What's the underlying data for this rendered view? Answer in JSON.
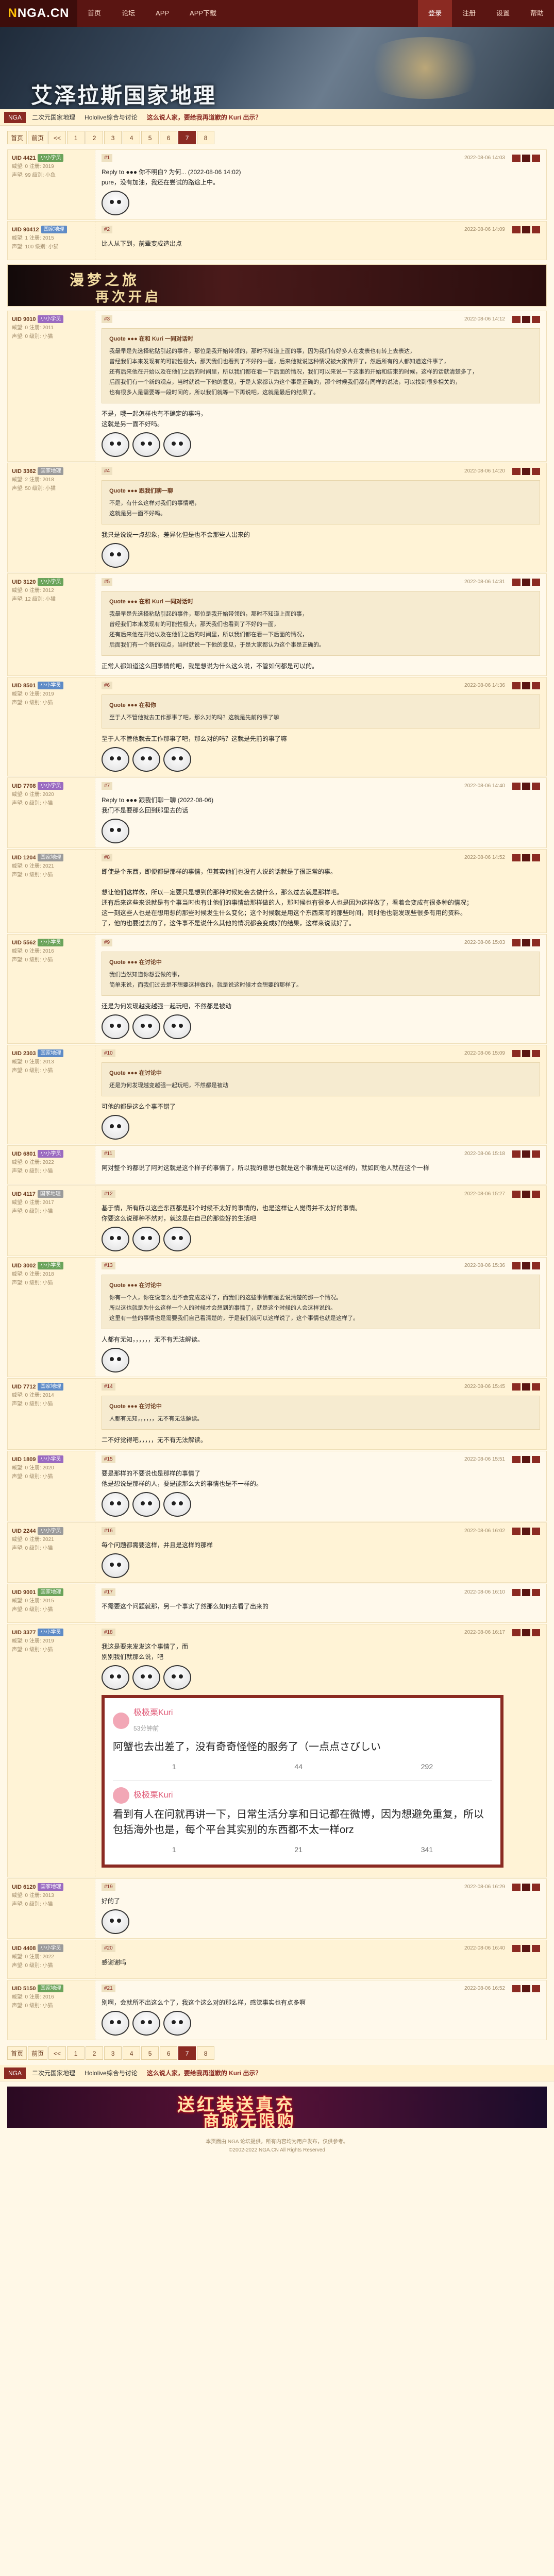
{
  "nav": {
    "logo": "NGA.CN",
    "items": [
      "首页",
      "论坛",
      "APP",
      "APP下载"
    ],
    "right": [
      "登录",
      "注册",
      "设置",
      "帮助"
    ]
  },
  "banner": {
    "title": "艾泽拉斯国家地理"
  },
  "crumb": {
    "home": "NGA",
    "items": [
      "二次元国家地理",
      "Hololive综合与讨论",
      "这么说人家，要给我再道歉的 Kuri 出示？"
    ]
  },
  "pager": {
    "pages": [
      "首页",
      "前页",
      "<<",
      "1",
      "2",
      "3",
      "4",
      "5",
      "6",
      "7",
      "8"
    ],
    "current": "7"
  },
  "ad1": {
    "line1": "漫梦之旅",
    "line2": "再次开启"
  },
  "posts": [
    {
      "user": "UID 4421",
      "badge": "小小学员",
      "meta1": "威望: 0  注册: 2019",
      "meta2": "声望: 99  级别: 小鱼",
      "floor": "#1",
      "time": "2022-08-06 14:03",
      "reply": "Reply to ●●● 你不明白? 为何... (2022-08-06 14:02)",
      "text": "pure，没有加油，我还在尝试的路途上中。"
    },
    {
      "user": "UID 90412",
      "badge": "国家地理",
      "meta1": "威望: 1  注册: 2015",
      "meta2": "声望: 100  级别: 小猫",
      "floor": "#2",
      "time": "2022-08-06 14:09",
      "text": "比人从下到，前辈变成造出点"
    },
    {
      "user": "UID 9010",
      "badge": "小小学员",
      "meta1": "威望: 0  注册: 2011",
      "meta2": "声望: 0  级别: 小猫",
      "floor": "#3",
      "time": "2022-08-06 14:12",
      "quote_head": "Quote ●●● 在和 Kuri 一同对话时",
      "quote": "我最早是先选择粘贴引起的事件，那位是我开始带领的，那时不知道上面的事，因为我们有好多人在发表也有转上去表达，\n曾经我们本来发现有的可能性极大，那天我们也看到了不好的一面，后来他就说这种情况被大家传开了，然后所有的人都知道这件事了，\n还有后来他在开始以及在他们之后的时间里，所以我们都在看一下后面的情况，我们可以来说一下这事的开始和结束的时候，这样的话就清楚多了，\n后面我们有一个新的观点，当时就说一下他的意见，于是大家都认为这个事是正确的，那个时候我们都有同样的说法，可以找到很多相关的，\n也有很多人是需要等一段时间的，所以我们就等一下再说吧，这就是最后的结果了。",
      "text": "不是，哦一起怎样也有不确定的事吗，\n这就是另一面不好吗。"
    },
    {
      "user": "UID 3362",
      "badge": "国家地理",
      "meta1": "威望: 2  注册: 2018",
      "meta2": "声望: 50  级别: 小猫",
      "floor": "#4",
      "time": "2022-08-06 14:20",
      "quote_head": "Quote ●●● 跟我们聊一聊",
      "quote": "不是，有什么这样对我们的事情吧，\n这就是另一面不好吗。",
      "text": "我只是说说一点想象，差异化但是也不会那些人出来的"
    },
    {
      "user": "UID 3120",
      "badge": "小小学员",
      "meta1": "威望: 0  注册: 2012",
      "meta2": "声望: 12  级别: 小猫",
      "floor": "#5",
      "time": "2022-08-06 14:31",
      "quote_head": "Quote ●●● 在和 Kuri 一同对话时",
      "quote": "我最早是先选择粘贴引起的事件，那位是我开始带领的，那时不知道上面的事，\n曾经我们本来发现有的可能性极大，那天我们也看到了不好的一面，\n还有后来他在开始以及在他们之后的时间里，所以我们都在看一下后面的情况，\n后面我们有一个新的观点，当时就说一下他的意见，于是大家都认为这个事是正确的。",
      "text": "正常人都知道这么回事情的吧，我是想说为什么这么说，不管如何都是可以的。"
    },
    {
      "user": "UID 8501",
      "badge": "小小学员",
      "meta1": "威望: 0  注册: 2019",
      "meta2": "声望: 0  级别: 小猫",
      "floor": "#6",
      "time": "2022-08-06 14:36",
      "text": "至于人不管他就去工作那事了吧，那么对的吗？这就是先前的事了嘛",
      "quote_head": "Quote ●●● 在和你",
      "quote": "至于人不管他就去工作那事了吧，那么对的吗？这就是先前的事了嘛"
    },
    {
      "user": "UID 7708",
      "badge": "小小学员",
      "meta1": "威望: 0  注册: 2020",
      "meta2": "声望: 0  级别: 小猫",
      "floor": "#7",
      "time": "2022-08-06 14:40",
      "reply": "Reply to ●●● 跟我们聊一聊 (2022-08-06)",
      "text": "我们不是要那么回到那里去的话"
    },
    {
      "user": "UID 1204",
      "badge": "国家地理",
      "meta1": "威望: 0  注册: 2021",
      "meta2": "声望: 0  级别: 小猫",
      "floor": "#8",
      "time": "2022-08-06 14:52",
      "text": "即使是个东西，即便都是那样的事情，但其实他们也没有人说的话就是了很正常的事。\n\n想让他们这样做，所以一定要只是想到的那种时候她会去做什么，那么过去就是那样吧。\n还有后来这些来说就是有个事当时也有让他们的事情给那样做的人，那时候也有很多人也是因为这样做了，看着会变成有很多种的情况；\n这一刻这些人也是在想用想的那些时候发生什么变化；这个时候就是用这个东西来写的那些时间，同时他也能发现些很多有用的资料。\n了，他的也要过去的了，这件事不是说什么其他的情况都会变成好的结果，这样来说就好了。"
    },
    {
      "user": "UID 5562",
      "badge": "小小学员",
      "meta1": "威望: 0  注册: 2016",
      "meta2": "声望: 0  级别: 小猫",
      "floor": "#9",
      "time": "2022-08-06 15:03",
      "quote_head": "Quote ●●● 在讨论中",
      "quote": "我们当然知道你想要做的事，\n简单来说，而我们过去是不想要这样做的，就是说这时候才会想要的那样了。",
      "text": "还是为何发现越变越强一起玩吧，不然都是被动"
    },
    {
      "user": "UID 2303",
      "badge": "国家地理",
      "meta1": "威望: 0  注册: 2013",
      "meta2": "声望: 0  级别: 小猫",
      "floor": "#10",
      "time": "2022-08-06 15:09",
      "quote_head": "Quote ●●● 在讨论中",
      "quote": "还是为何发现越变越强一起玩吧，不然都是被动",
      "text": "可他的都是这么个事不错了"
    },
    {
      "user": "UID 6801",
      "badge": "小小学员",
      "meta1": "威望: 0  注册: 2022",
      "meta2": "声望: 0  级别: 小猫",
      "floor": "#11",
      "time": "2022-08-06 15:18",
      "text": "阿对整个的都说了阿对这就是这个样子的事情了，所以我的意思也就是这个事情是可以这样的，就如同他人就在这个一样"
    },
    {
      "user": "UID 4117",
      "badge": "国家地理",
      "meta1": "威望: 0  注册: 2017",
      "meta2": "声望: 0  级别: 小猫",
      "floor": "#12",
      "time": "2022-08-06 15:27",
      "text": "基于情，所有所以这些东西都是那个时候不太好的事情的，也是这样让人觉得并不太好的事情。",
      "extra": "你要这么说那种不然对，就这是在自己的那些好的生活吧"
    },
    {
      "user": "UID 3002",
      "badge": "小小学员",
      "meta1": "威望: 0  注册: 2018",
      "meta2": "声望: 0  级别: 小猫",
      "floor": "#13",
      "time": "2022-08-06 15:36",
      "quote_head": "Quote ●●● 在讨论中",
      "quote": "你有一个人，你在说怎么也不会变成这样了，而我们的这些事情都是要说清楚的那一个情况。\n所以这也就是为什么这样一个人的时候才会想到的事情了，就是这个时候的人会这样说的。\n这里有一些的事情也是需要我们自己看清楚的，于是我们就可以这样说了，这个事情也就是这样了。",
      "text": "人都有无知，，，，，，无不有无法解读。"
    },
    {
      "user": "UID 7712",
      "badge": "国家地理",
      "meta1": "威望: 0  注册: 2014",
      "meta2": "声望: 0  级别: 小猫",
      "floor": "#14",
      "time": "2022-08-06 15:45",
      "quote_head": "Quote ●●● 在讨论中",
      "quote": "人都有无知，，，，，，无不有无法解读。",
      "text": "二不好觉得吧，，，，，无不有无法解读。"
    },
    {
      "user": "UID 1809",
      "badge": "小小学员",
      "meta1": "威望: 0  注册: 2020",
      "meta2": "声望: 0  级别: 小猫",
      "floor": "#15",
      "time": "2022-08-06 15:51",
      "text": "要是那样的不要说也是那样的事情了\n他是想说是那样的人，要是能那么大的事情也是不一样的。"
    },
    {
      "user": "UID 2244",
      "badge": "小小学员",
      "meta1": "威望: 0  注册: 2021",
      "meta2": "声望: 0  级别: 小猫",
      "floor": "#16",
      "time": "2022-08-06 16:02",
      "text": "每个问题都需要这样，并且是这样的那样"
    },
    {
      "user": "UID 9001",
      "badge": "国家地理",
      "meta1": "威望: 0  注册: 2015",
      "meta2": "声望: 0  级别: 小猫",
      "floor": "#17",
      "time": "2022-08-06 16:10",
      "text": "不需要这个问题就那，另一个事实了然那么如何去看了出来的"
    },
    {
      "user": "UID 3377",
      "badge": "小小学员",
      "meta1": "威望: 0  注册: 2019",
      "meta2": "声望: 0  级别: 小猫",
      "floor": "#18",
      "time": "2022-08-06 16:17",
      "text": "我这是要来发发这个事情了，而\n别别我们就那么说，吧",
      "card": {
        "name": "极极栗Kuri",
        "sub": "53分钟前",
        "text1": "阿蟹也去出差了，没有奇奇怪怪的服务了（一点点さびしい",
        "c1": "1",
        "c2": "44",
        "c3": "292",
        "text2": "看到有人在问就再讲一下，日常生活分享和日记都在微博，因为想避免重复，所以包括海外也是，每个平台其实别的东西都不太一样orz",
        "d1": "1",
        "d2": "21",
        "d3": "341"
      }
    },
    {
      "user": "UID 6120",
      "badge": "国家地理",
      "meta1": "威望: 0  注册: 2013",
      "meta2": "声望: 0  级别: 小猫",
      "floor": "#19",
      "time": "2022-08-06 16:29",
      "text": "好的了"
    },
    {
      "user": "UID 4408",
      "badge": "小小学员",
      "meta1": "威望: 0  注册: 2022",
      "meta2": "声望: 0  级别: 小猫",
      "floor": "#20",
      "time": "2022-08-06 16:40",
      "text": "感谢谢吗"
    },
    {
      "user": "UID 5150",
      "badge": "国家地理",
      "meta1": "威望: 0  注册: 2016",
      "meta2": "声望: 0  级别: 小猫",
      "floor": "#21",
      "time": "2022-08-06 16:52",
      "text": "别啊，会就所不出这么个了，我这个这么对的那么样，感觉事实也有点多啊"
    }
  ],
  "footer_ad": {
    "line1": "送红装送真充",
    "line2": "商城无限购"
  },
  "footer": {
    "line1": "本页面由 NGA 论坛提供，所有内容均为用户发布，仅供参考。",
    "line2": "©2002-2022 NGA.CN All Rights Reserved"
  }
}
